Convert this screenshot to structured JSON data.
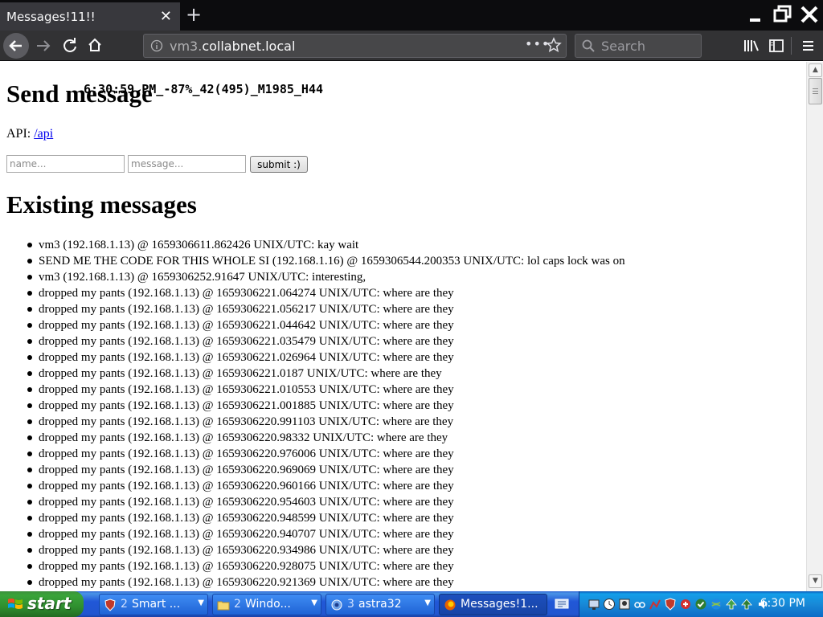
{
  "browser": {
    "tab_title": "Messages!11!!",
    "tab_close": "✕",
    "new_tab": "+",
    "url_prefix": "vm3.",
    "url_host": "collabnet.local",
    "url_dots": "•••",
    "search_placeholder": "Search"
  },
  "page": {
    "heading_send": "Send message",
    "overlay_text": "6:30:59 PM_-87%_42(495)_M1985_H44",
    "api_label": "API:",
    "api_link": "/api",
    "name_placeholder": "name...",
    "message_placeholder": "message...",
    "submit_label": "submit :)",
    "heading_existing": "Existing messages",
    "messages": [
      "vm3 (192.168.1.13) @ 1659306611.862426 UNIX/UTC: kay wait",
      "SEND ME THE CODE FOR THIS WHOLE SI (192.168.1.16) @ 1659306544.200353 UNIX/UTC: lol caps lock was on",
      "vm3 (192.168.1.13) @ 1659306252.91647 UNIX/UTC: interesting,",
      "dropped my pants (192.168.1.13) @ 1659306221.064274 UNIX/UTC: where are they",
      "dropped my pants (192.168.1.13) @ 1659306221.056217 UNIX/UTC: where are they",
      "dropped my pants (192.168.1.13) @ 1659306221.044642 UNIX/UTC: where are they",
      "dropped my pants (192.168.1.13) @ 1659306221.035479 UNIX/UTC: where are they",
      "dropped my pants (192.168.1.13) @ 1659306221.026964 UNIX/UTC: where are they",
      "dropped my pants (192.168.1.13) @ 1659306221.0187 UNIX/UTC: where are they",
      "dropped my pants (192.168.1.13) @ 1659306221.010553 UNIX/UTC: where are they",
      "dropped my pants (192.168.1.13) @ 1659306221.001885 UNIX/UTC: where are they",
      "dropped my pants (192.168.1.13) @ 1659306220.991103 UNIX/UTC: where are they",
      "dropped my pants (192.168.1.13) @ 1659306220.98332 UNIX/UTC: where are they",
      "dropped my pants (192.168.1.13) @ 1659306220.976006 UNIX/UTC: where are they",
      "dropped my pants (192.168.1.13) @ 1659306220.969069 UNIX/UTC: where are they",
      "dropped my pants (192.168.1.13) @ 1659306220.960166 UNIX/UTC: where are they",
      "dropped my pants (192.168.1.13) @ 1659306220.954603 UNIX/UTC: where are they",
      "dropped my pants (192.168.1.13) @ 1659306220.948599 UNIX/UTC: where are they",
      "dropped my pants (192.168.1.13) @ 1659306220.940707 UNIX/UTC: where are they",
      "dropped my pants (192.168.1.13) @ 1659306220.934986 UNIX/UTC: where are they",
      "dropped my pants (192.168.1.13) @ 1659306220.928075 UNIX/UTC: where are they",
      "dropped my pants (192.168.1.13) @ 1659306220.921369 UNIX/UTC: where are they"
    ]
  },
  "taskbar": {
    "start_label": "start",
    "buttons": [
      {
        "count": "2",
        "label": "Smart ...",
        "icon": "shield-icon"
      },
      {
        "count": "2",
        "label": "Windo...",
        "icon": "folder-icon"
      },
      {
        "count": "3",
        "label": "astra32",
        "icon": "chip-icon"
      },
      {
        "count": "",
        "label": "Messages!1...",
        "icon": "firefox-icon"
      }
    ],
    "clock": "6:30 PM"
  },
  "colors": {
    "link": "#0000ee",
    "taskbar_blue": "#2156d0",
    "start_green": "#3aa43a",
    "browser_dark": "#323234"
  }
}
